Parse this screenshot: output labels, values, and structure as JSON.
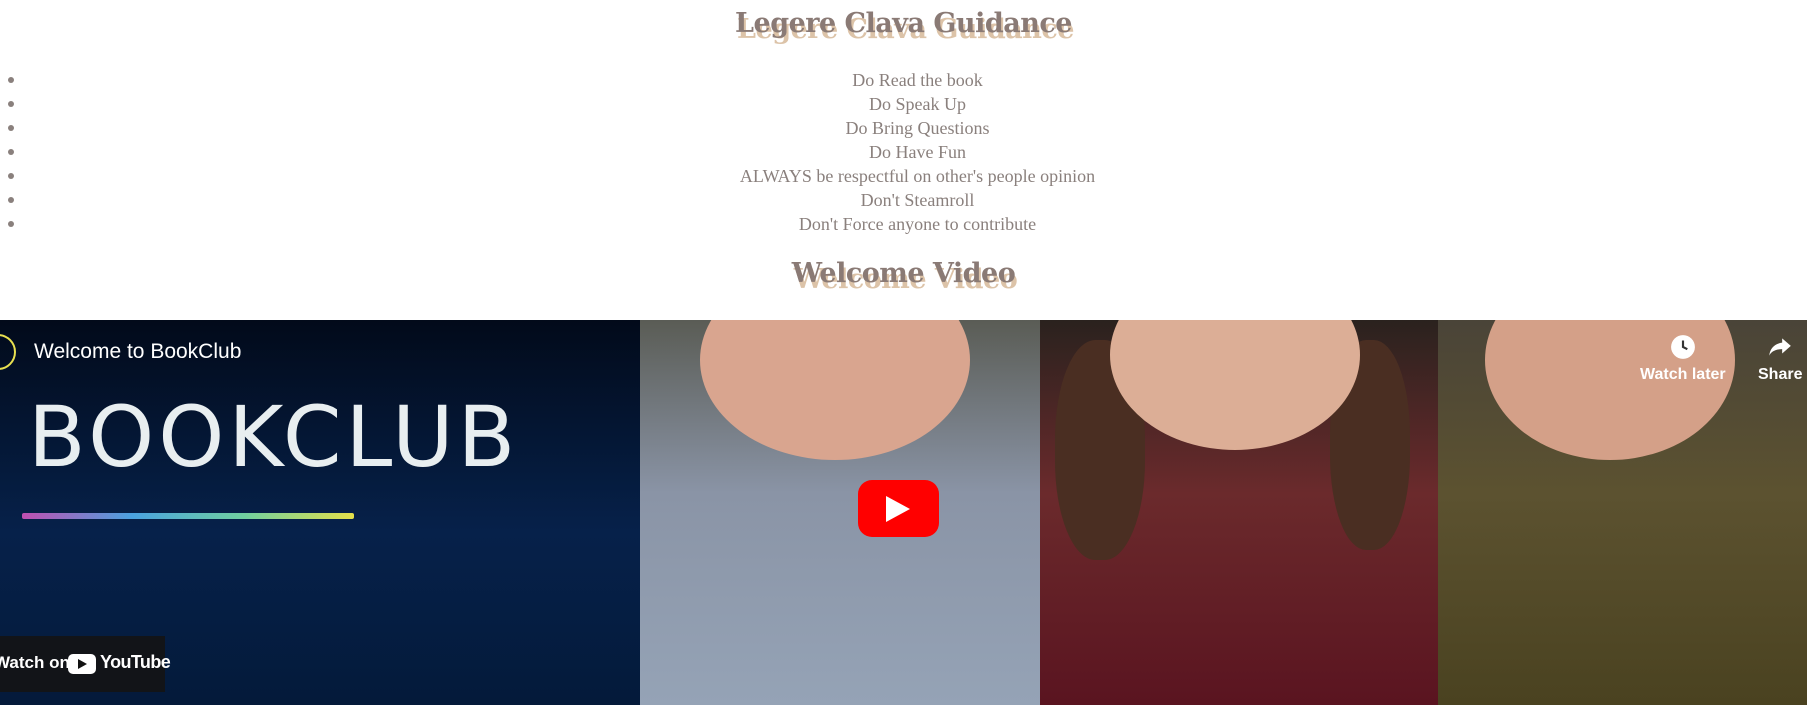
{
  "page": {
    "guidance_title": "Legere Clava Guidance",
    "rules": [
      "Do Read the book",
      "Do Speak Up",
      "Do Bring Questions",
      "Do Have Fun",
      "ALWAYS be respectful on other's people opinion",
      "Don't Steamroll",
      "Don't Force anyone to contribute"
    ],
    "video_title": "Welcome Video"
  },
  "video": {
    "title": "Welcome to BookClub",
    "thumbnail_text": "BOOKCLUB",
    "watch_later_label": "Watch later",
    "share_label": "Share",
    "watch_on_label": "Watch on",
    "youtube_label": "YouTube"
  },
  "colors": {
    "heading": "#8a7a75",
    "heading_shadow": "#dcc3a8",
    "text": "#8a807d",
    "play_button": "#ff0000"
  },
  "icons": [
    "clock-icon",
    "share-arrow-icon",
    "play-icon",
    "youtube-logo-icon",
    "channel-avatar-icon"
  ]
}
